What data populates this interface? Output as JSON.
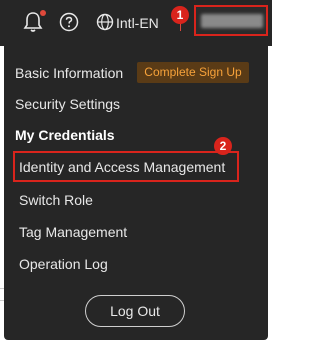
{
  "topbar": {
    "bell_icon": "bell-icon",
    "help_icon": "help-circle-icon",
    "globe_icon": "globe-icon",
    "language_label": "Intl-EN",
    "account_name": ""
  },
  "annotations": {
    "step1": "1",
    "step2": "2"
  },
  "menu": {
    "items": [
      {
        "label": "Basic Information"
      },
      {
        "label": "Security Settings"
      },
      {
        "label": "My Credentials"
      },
      {
        "label": "Identity and Access Management"
      },
      {
        "label": "Switch Role"
      },
      {
        "label": "Tag Management"
      },
      {
        "label": "Operation Log"
      }
    ],
    "signup_badge": "Complete Sign Up",
    "logout_label": "Log Out"
  },
  "colors": {
    "panel": "#262626",
    "highlight": "#d9241c",
    "badge_text": "#f7a23a"
  }
}
